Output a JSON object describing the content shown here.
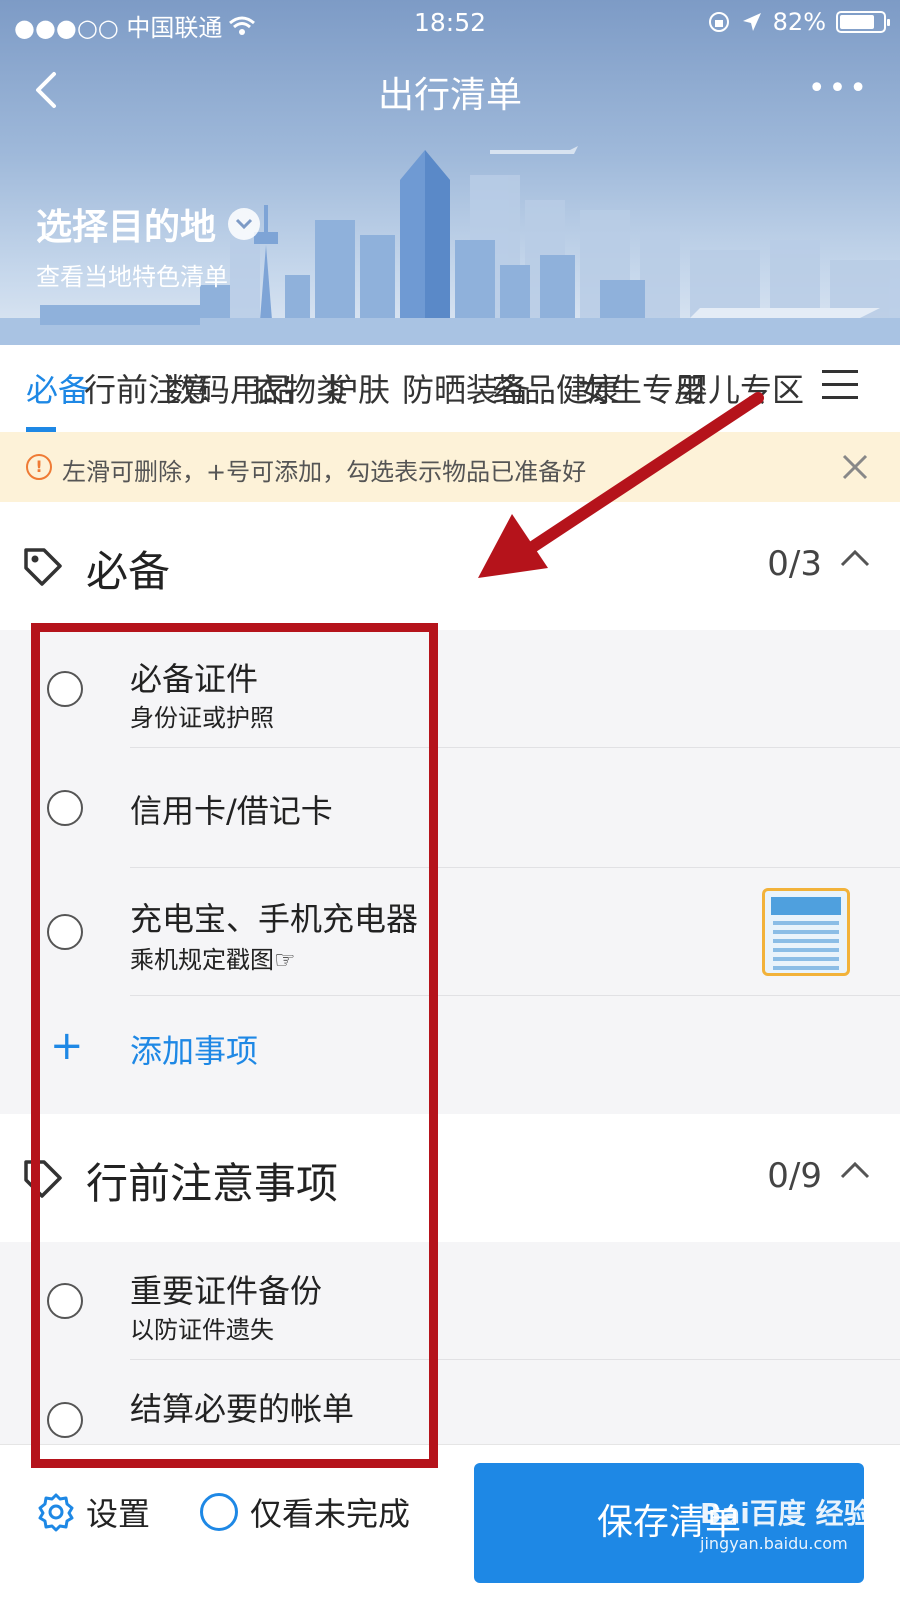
{
  "status_bar": {
    "carrier": "●●●○○ 中国联通",
    "time": "18:52",
    "battery": "82%",
    "battery_level": 0.82
  },
  "nav": {
    "title": "出行清单"
  },
  "destination": {
    "title": "选择目的地",
    "subtitle": "查看当地特色清单"
  },
  "tabs": [
    {
      "label": "必备",
      "active": true
    },
    {
      "label": "行前注意",
      "active": false
    },
    {
      "label": "数码用品",
      "active": false
    },
    {
      "label": "衣物类",
      "active": false
    },
    {
      "label": "护肤",
      "active": false
    },
    {
      "label": "防晒装备",
      "active": false
    },
    {
      "label": "药品健康",
      "active": false
    },
    {
      "label": "女生专用",
      "active": false
    },
    {
      "label": "婴儿专区",
      "active": false
    }
  ],
  "notice": {
    "text": "左滑可删除，+号可添加，勾选表示物品已准备好"
  },
  "sections": [
    {
      "title": "必备",
      "count": "0/3",
      "items": [
        {
          "name": "必备证件",
          "sub": "身份证或护照"
        },
        {
          "name": "信用卡/借记卡",
          "sub": ""
        },
        {
          "name": "充电宝、手机充电器",
          "sub": "乘机规定戳图☞"
        }
      ],
      "add_label": "添加事项"
    },
    {
      "title": "行前注意事项",
      "count": "0/9",
      "items": [
        {
          "name": "重要证件备份",
          "sub": "以防证件遗失"
        },
        {
          "name": "结算必要的帐单",
          "sub": ""
        }
      ]
    }
  ],
  "bottom": {
    "settings_label": "设置",
    "filter_label": "仅看未完成",
    "save_label": "保存清单"
  },
  "watermark": {
    "main": "Bai百度 经验",
    "sub": "jingyan.baidu.com"
  },
  "colors": {
    "accent": "#1e88e5",
    "annotation": "#b5131b",
    "notice_bg": "#fdf2d8"
  }
}
